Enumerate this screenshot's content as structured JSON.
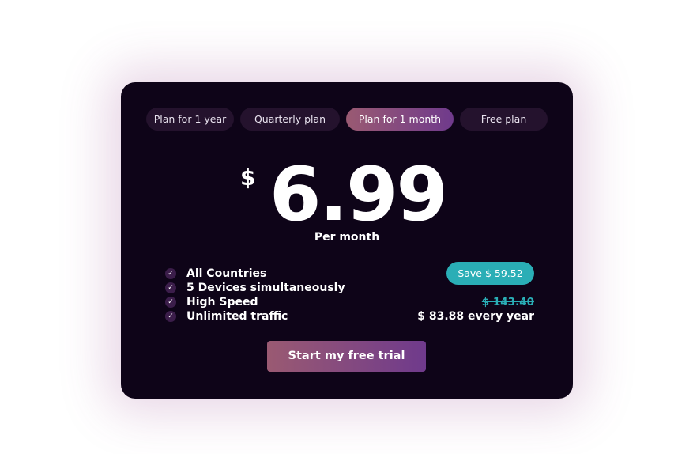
{
  "tabs": [
    {
      "label": "Plan for 1 year",
      "active": false
    },
    {
      "label": "Quarterly plan",
      "active": false
    },
    {
      "label": "Plan for 1 month",
      "active": true
    },
    {
      "label": "Free plan",
      "active": false
    }
  ],
  "price": {
    "currency": "$",
    "amount": "6.99",
    "period": "Per month"
  },
  "features": [
    {
      "icon": "check-icon",
      "label": "All Countries"
    },
    {
      "icon": "check-icon",
      "label": "5 Devices simultaneously"
    },
    {
      "icon": "check-icon",
      "label": "High Speed"
    },
    {
      "icon": "check-icon",
      "label": "Unlimited traffic"
    }
  ],
  "savings": {
    "badge": "Save $ 59.52",
    "old_price": "$ 143.40",
    "yearly_price": "$ 83.88 every year"
  },
  "cta": {
    "label": "Start my free trial"
  },
  "colors": {
    "card_background": "#0e0418",
    "accent_gradient_start": "#9a5a72",
    "accent_gradient_end": "#6f3a8c",
    "teal": "#2aaeb6"
  }
}
